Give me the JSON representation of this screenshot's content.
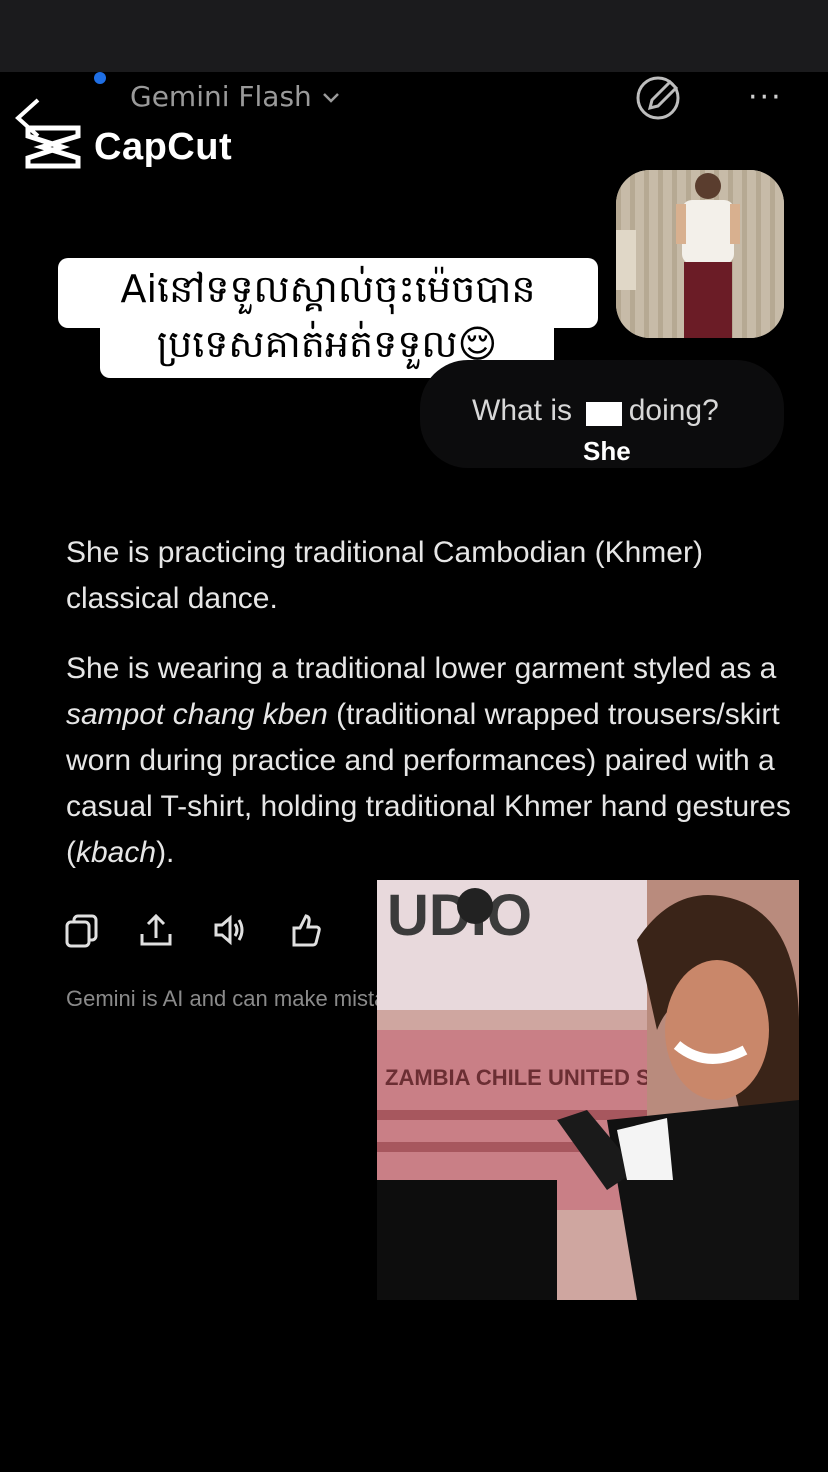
{
  "header": {
    "model_name": "Gemini",
    "model_variant": "Flash",
    "chevron": "chevron-down-icon",
    "edit_icon": "edit-icon",
    "more_icon": "more-icon",
    "more_glyph": "···"
  },
  "watermark": {
    "brand": "CapCut"
  },
  "caption": {
    "line1": "Aiនៅទទួលស្គាល់ចុះម៉េចបាន",
    "line2": "ប្រទេសគាត់អត់ទទួល😌"
  },
  "user_message": {
    "text": "What is her doing?",
    "text_pre": "What is ",
    "text_post": " doing?",
    "correction_overlay": "She"
  },
  "response": {
    "p1": "She is practicing traditional Cambodian (Khmer) classical dance.",
    "p2_a": "She is wearing a traditional lower garment styled as a ",
    "p2_em1": "sampot chang kben",
    "p2_b": " (traditional wrapped trousers/skirt worn during practice and performances) paired with a casual T-shirt, holding traditional Khmer hand gestures (",
    "p2_em2": "kbach",
    "p2_c": ")."
  },
  "actions": [
    "copy-icon",
    "share-icon",
    "speaker-icon",
    "thumbs-up-icon"
  ],
  "disclaimer": "Gemini is AI and can make mistakes.",
  "overlay_video": {
    "sign_text": "UDIO",
    "banner_text": "ZAMBIA CHILE UNITED STATES"
  },
  "colors": {
    "accent_dot": "#1f6fe5",
    "background": "#000000",
    "topbar": "#1b1b1d"
  }
}
